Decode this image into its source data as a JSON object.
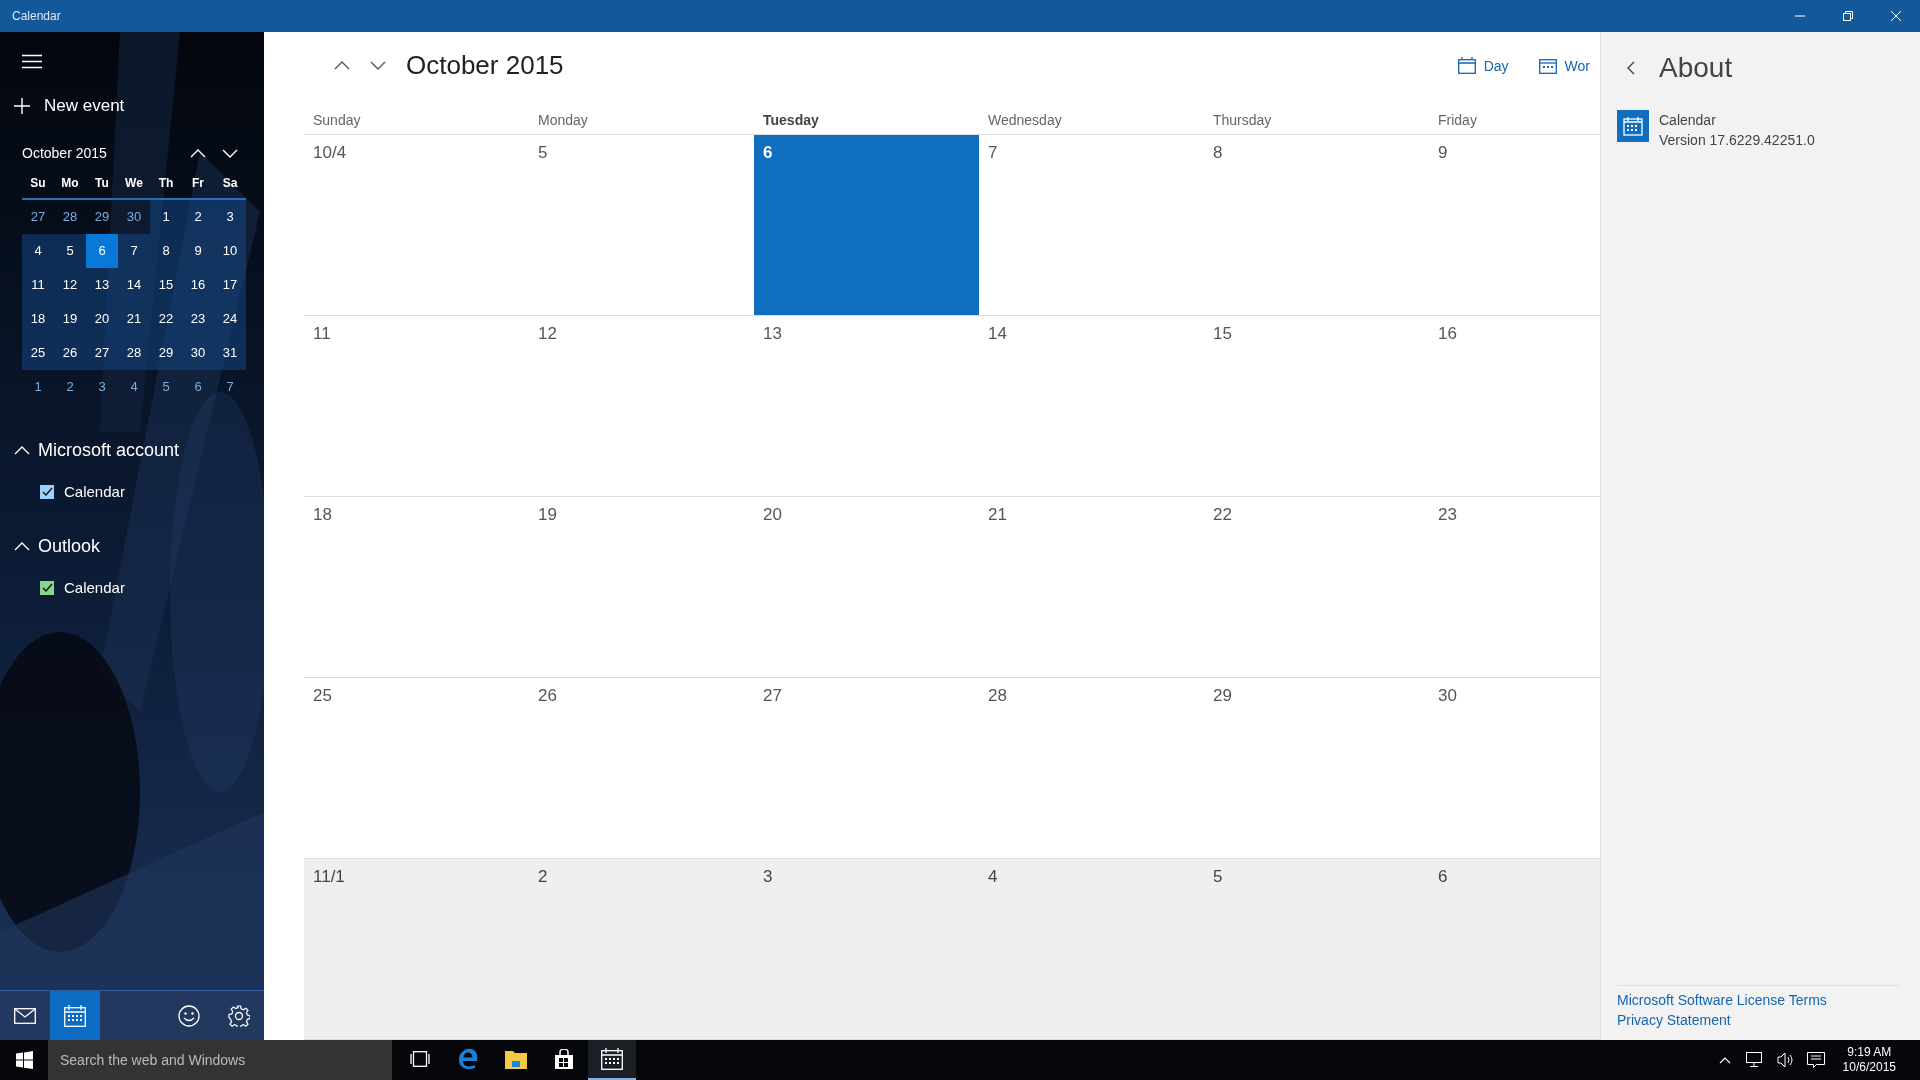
{
  "window": {
    "title": "Calendar"
  },
  "sidebar": {
    "new_event": "New event",
    "mini_calendar": {
      "title": "October 2015",
      "weekdays": [
        "Su",
        "Mo",
        "Tu",
        "We",
        "Th",
        "Fr",
        "Sa"
      ],
      "weeks": [
        [
          {
            "day": "27",
            "in_month": false,
            "selected": false
          },
          {
            "day": "28",
            "in_month": false,
            "selected": false
          },
          {
            "day": "29",
            "in_month": false,
            "selected": false
          },
          {
            "day": "30",
            "in_month": false,
            "selected": false
          },
          {
            "day": "1",
            "in_month": true,
            "selected": false
          },
          {
            "day": "2",
            "in_month": true,
            "selected": false
          },
          {
            "day": "3",
            "in_month": true,
            "selected": false
          }
        ],
        [
          {
            "day": "4",
            "in_month": true,
            "selected": false
          },
          {
            "day": "5",
            "in_month": true,
            "selected": false
          },
          {
            "day": "6",
            "in_month": true,
            "selected": true
          },
          {
            "day": "7",
            "in_month": true,
            "selected": false
          },
          {
            "day": "8",
            "in_month": true,
            "selected": false
          },
          {
            "day": "9",
            "in_month": true,
            "selected": false
          },
          {
            "day": "10",
            "in_month": true,
            "selected": false
          }
        ],
        [
          {
            "day": "11",
            "in_month": true,
            "selected": false
          },
          {
            "day": "12",
            "in_month": true,
            "selected": false
          },
          {
            "day": "13",
            "in_month": true,
            "selected": false
          },
          {
            "day": "14",
            "in_month": true,
            "selected": false
          },
          {
            "day": "15",
            "in_month": true,
            "selected": false
          },
          {
            "day": "16",
            "in_month": true,
            "selected": false
          },
          {
            "day": "17",
            "in_month": true,
            "selected": false
          }
        ],
        [
          {
            "day": "18",
            "in_month": true,
            "selected": false
          },
          {
            "day": "19",
            "in_month": true,
            "selected": false
          },
          {
            "day": "20",
            "in_month": true,
            "selected": false
          },
          {
            "day": "21",
            "in_month": true,
            "selected": false
          },
          {
            "day": "22",
            "in_month": true,
            "selected": false
          },
          {
            "day": "23",
            "in_month": true,
            "selected": false
          },
          {
            "day": "24",
            "in_month": true,
            "selected": false
          }
        ],
        [
          {
            "day": "25",
            "in_month": true,
            "selected": false
          },
          {
            "day": "26",
            "in_month": true,
            "selected": false
          },
          {
            "day": "27",
            "in_month": true,
            "selected": false
          },
          {
            "day": "28",
            "in_month": true,
            "selected": false
          },
          {
            "day": "29",
            "in_month": true,
            "selected": false
          },
          {
            "day": "30",
            "in_month": true,
            "selected": false
          },
          {
            "day": "31",
            "in_month": true,
            "selected": false
          }
        ],
        [
          {
            "day": "1",
            "in_month": false,
            "selected": false
          },
          {
            "day": "2",
            "in_month": false,
            "selected": false
          },
          {
            "day": "3",
            "in_month": false,
            "selected": false
          },
          {
            "day": "4",
            "in_month": false,
            "selected": false
          },
          {
            "day": "5",
            "in_month": false,
            "selected": false
          },
          {
            "day": "6",
            "in_month": false,
            "selected": false
          },
          {
            "day": "7",
            "in_month": false,
            "selected": false
          }
        ]
      ]
    },
    "accounts": [
      {
        "name": "Microsoft account",
        "expanded": true,
        "calendars": [
          {
            "name": "Calendar",
            "checked": true,
            "color": "#9fd0fb"
          }
        ]
      },
      {
        "name": "Outlook",
        "expanded": true,
        "calendars": [
          {
            "name": "Calendar",
            "checked": true,
            "color": "#88d68c"
          }
        ]
      }
    ],
    "bottom_nav": [
      {
        "kind": "mail",
        "selected": false
      },
      {
        "kind": "calendar",
        "selected": true
      },
      {
        "kind": "feedback",
        "selected": false
      },
      {
        "kind": "settings",
        "selected": false
      }
    ]
  },
  "month_view": {
    "title": "October 2015",
    "views": [
      {
        "kind": "day",
        "label": "Day"
      },
      {
        "kind": "workweek",
        "label": "Wor"
      }
    ],
    "columns": [
      {
        "label": "Sunday",
        "selected": false
      },
      {
        "label": "Monday",
        "selected": false
      },
      {
        "label": "Tuesday",
        "selected": true
      },
      {
        "label": "Wednesday",
        "selected": false
      },
      {
        "label": "Thursday",
        "selected": false
      },
      {
        "label": "Friday",
        "selected": false
      }
    ],
    "weeks": [
      [
        {
          "label": "10/4",
          "in_month": true,
          "selected": false
        },
        {
          "label": "5",
          "in_month": true,
          "selected": false
        },
        {
          "label": "6",
          "in_month": true,
          "selected": true
        },
        {
          "label": "7",
          "in_month": true,
          "selected": false
        },
        {
          "label": "8",
          "in_month": true,
          "selected": false
        },
        {
          "label": "9",
          "in_month": true,
          "selected": false
        }
      ],
      [
        {
          "label": "11",
          "in_month": true,
          "selected": false
        },
        {
          "label": "12",
          "in_month": true,
          "selected": false
        },
        {
          "label": "13",
          "in_month": true,
          "selected": false
        },
        {
          "label": "14",
          "in_month": true,
          "selected": false
        },
        {
          "label": "15",
          "in_month": true,
          "selected": false
        },
        {
          "label": "16",
          "in_month": true,
          "selected": false
        }
      ],
      [
        {
          "label": "18",
          "in_month": true,
          "selected": false
        },
        {
          "label": "19",
          "in_month": true,
          "selected": false
        },
        {
          "label": "20",
          "in_month": true,
          "selected": false
        },
        {
          "label": "21",
          "in_month": true,
          "selected": false
        },
        {
          "label": "22",
          "in_month": true,
          "selected": false
        },
        {
          "label": "23",
          "in_month": true,
          "selected": false
        }
      ],
      [
        {
          "label": "25",
          "in_month": true,
          "selected": false
        },
        {
          "label": "26",
          "in_month": true,
          "selected": false
        },
        {
          "label": "27",
          "in_month": true,
          "selected": false
        },
        {
          "label": "28",
          "in_month": true,
          "selected": false
        },
        {
          "label": "29",
          "in_month": true,
          "selected": false
        },
        {
          "label": "30",
          "in_month": true,
          "selected": false
        }
      ],
      [
        {
          "label": "11/1",
          "in_month": false,
          "selected": false
        },
        {
          "label": "2",
          "in_month": false,
          "selected": false
        },
        {
          "label": "3",
          "in_month": false,
          "selected": false
        },
        {
          "label": "4",
          "in_month": false,
          "selected": false
        },
        {
          "label": "5",
          "in_month": false,
          "selected": false
        },
        {
          "label": "6",
          "in_month": false,
          "selected": false
        }
      ]
    ]
  },
  "about_panel": {
    "title": "About",
    "app_name": "Calendar",
    "version": "Version 17.6229.42251.0",
    "links": [
      "Microsoft Software License Terms",
      "Privacy Statement"
    ]
  },
  "taskbar": {
    "search": {
      "placeholder": "Search the web and Windows"
    },
    "apps": [
      {
        "kind": "task-view",
        "running": false
      },
      {
        "kind": "edge",
        "running": false
      },
      {
        "kind": "explorer",
        "running": false
      },
      {
        "kind": "store",
        "running": false
      },
      {
        "kind": "calendar",
        "running": true
      }
    ],
    "tray": {
      "time": "9:19 AM",
      "date": "10/6/2015"
    }
  }
}
